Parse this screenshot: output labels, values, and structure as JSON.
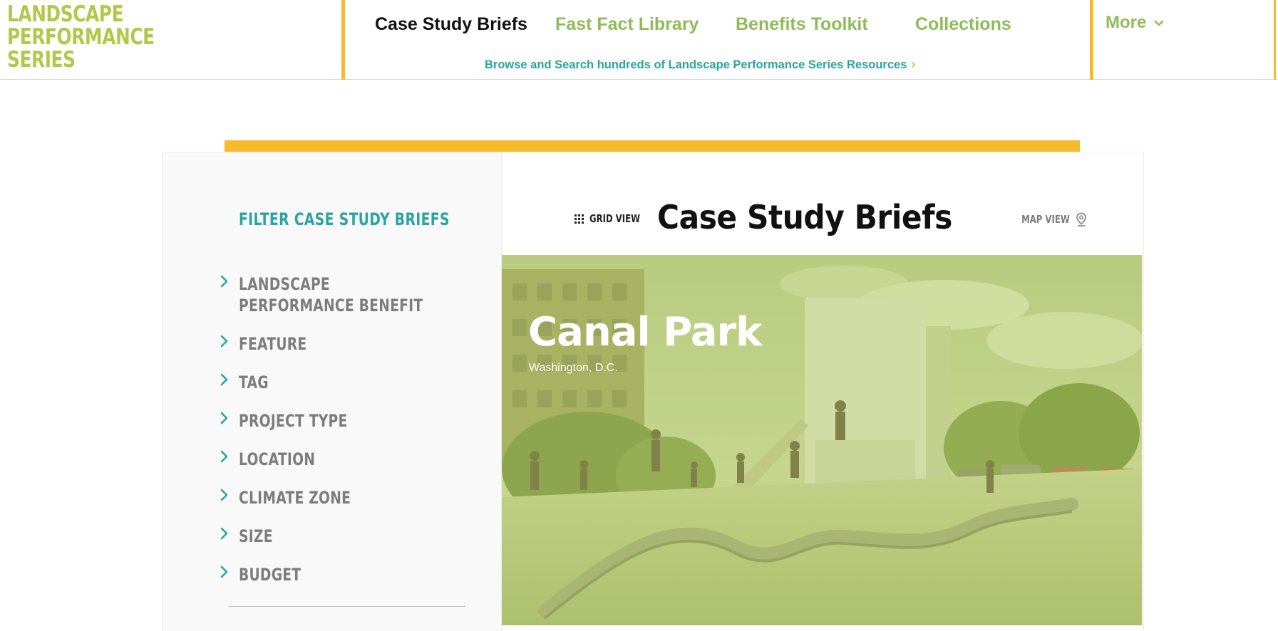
{
  "logo": {
    "lines": [
      "LANDSCAPE",
      "PERFORMANCE",
      "SERIES"
    ]
  },
  "nav": {
    "items": [
      {
        "label": "Case Study Briefs"
      },
      {
        "label": "Fast Fact Library"
      },
      {
        "label": "Benefits Toolkit"
      },
      {
        "label": "Collections"
      }
    ],
    "browse_label": "Browse and Search hundreds of Landscape Performance Series Resources",
    "more_label": "More"
  },
  "sidebar": {
    "title": "FILTER CASE STUDY BRIEFS",
    "filters": [
      {
        "label": "LANDSCAPE PERFORMANCE BENEFIT"
      },
      {
        "label": "FEATURE"
      },
      {
        "label": "TAG"
      },
      {
        "label": "PROJECT TYPE"
      },
      {
        "label": "LOCATION"
      },
      {
        "label": "CLIMATE ZONE"
      },
      {
        "label": "SIZE"
      },
      {
        "label": "BUDGET"
      }
    ]
  },
  "content": {
    "title": "Case Study Briefs",
    "grid_view_label": "GRID VIEW",
    "map_view_label": "MAP VIEW",
    "card": {
      "title": "Canal Park",
      "location": "Washington, D.C."
    }
  },
  "icons": {
    "filter_chevron": "chevron-right-icon",
    "browse_chevron": "chevron-right-icon",
    "more_chevron": "chevron-down-icon",
    "grid": "grid-icon",
    "map": "map-pin-icon"
  },
  "colors": {
    "brand_green": "#b3c84b",
    "nav_green": "#8fbc5b",
    "teal": "#2aa4a0",
    "yellow": "#f6ba2d",
    "text_dark": "#111111",
    "text_gray": "#7d7d7d"
  }
}
